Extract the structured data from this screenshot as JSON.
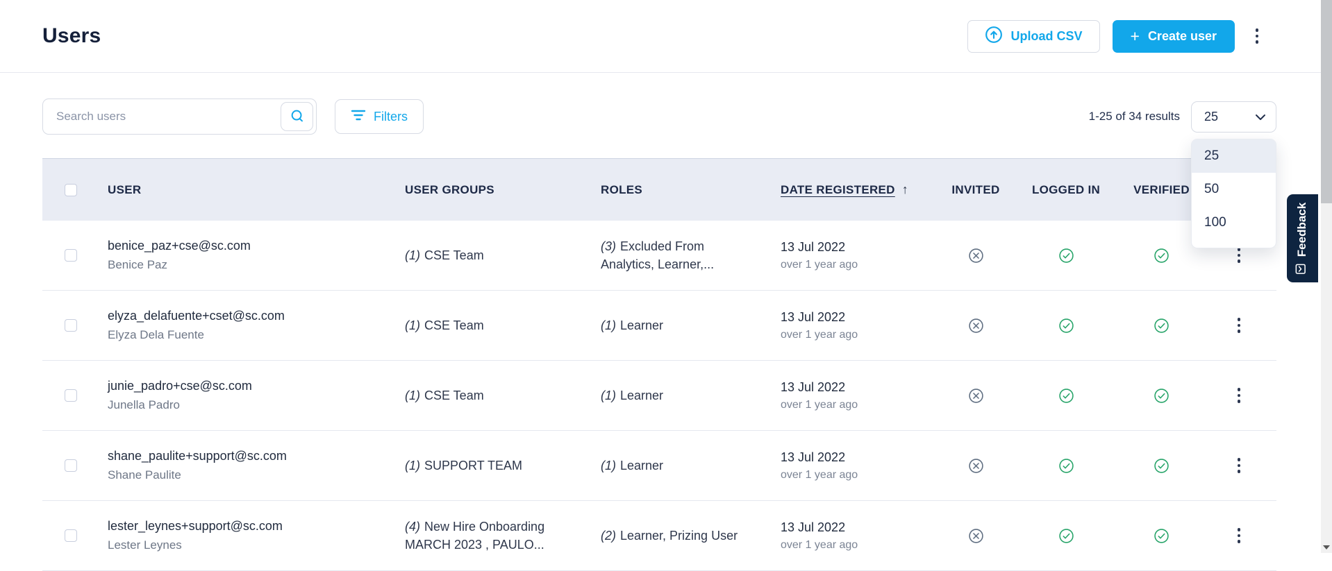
{
  "page": {
    "title": "Users"
  },
  "header": {
    "upload_button": {
      "label": "Upload CSV"
    },
    "create_button": {
      "label": "Create user",
      "plus": "+"
    }
  },
  "toolbar": {
    "search": {
      "placeholder": "Search users",
      "value": ""
    },
    "filters": {
      "label": "Filters"
    },
    "results_text": "1-25 of 34 results",
    "page_size": {
      "value": "25",
      "options": [
        "25",
        "50",
        "100"
      ]
    }
  },
  "table": {
    "columns": {
      "user": "USER",
      "user_groups": "USER GROUPS",
      "roles": "ROLES",
      "date_registered": "DATE REGISTERED",
      "invited": "INVITED",
      "logged_in": "LOGGED IN",
      "verified": "VERIFIED"
    },
    "sort": {
      "column": "DATE REGISTERED",
      "direction": "ascending",
      "arrow": "↑"
    },
    "rows": [
      {
        "email": "benice_paz+cse@sc.com",
        "name": "Benice Paz",
        "groups_count": "(1)",
        "groups": "CSE Team",
        "roles_count": "(3)",
        "roles": "Excluded From Analytics, Learner,...",
        "date": "13 Jul 2022",
        "date_relative": "over 1 year ago",
        "invited": "no",
        "logged_in": "yes",
        "verified": "yes"
      },
      {
        "email": "elyza_delafuente+cset@sc.com",
        "name": "Elyza Dela Fuente",
        "groups_count": "(1)",
        "groups": "CSE Team",
        "roles_count": "(1)",
        "roles": "Learner",
        "date": "13 Jul 2022",
        "date_relative": "over 1 year ago",
        "invited": "no",
        "logged_in": "yes",
        "verified": "yes"
      },
      {
        "email": "junie_padro+cse@sc.com",
        "name": "Junella Padro",
        "groups_count": "(1)",
        "groups": "CSE Team",
        "roles_count": "(1)",
        "roles": "Learner",
        "date": "13 Jul 2022",
        "date_relative": "over 1 year ago",
        "invited": "no",
        "logged_in": "yes",
        "verified": "yes"
      },
      {
        "email": "shane_paulite+support@sc.com",
        "name": "Shane Paulite",
        "groups_count": "(1)",
        "groups": "SUPPORT TEAM",
        "roles_count": "(1)",
        "roles": "Learner",
        "date": "13 Jul 2022",
        "date_relative": "over 1 year ago",
        "invited": "no",
        "logged_in": "yes",
        "verified": "yes"
      },
      {
        "email": "lester_leynes+support@sc.com",
        "name": "Lester Leynes",
        "groups_count": "(4)",
        "groups": "New Hire Onboarding MARCH 2023 , PAULO...",
        "roles_count": "(2)",
        "roles": "Learner, Prizing User",
        "date": "13 Jul 2022",
        "date_relative": "over 1 year ago",
        "invited": "no",
        "logged_in": "yes",
        "verified": "yes"
      }
    ]
  },
  "feedback": {
    "label": "Feedback"
  },
  "colors": {
    "accent": "#12a7ea",
    "success": "#27a469",
    "neutral_icon": "#5f6e81",
    "header_bg": "#e9ecf4",
    "feedback_bg": "#0e2440"
  }
}
